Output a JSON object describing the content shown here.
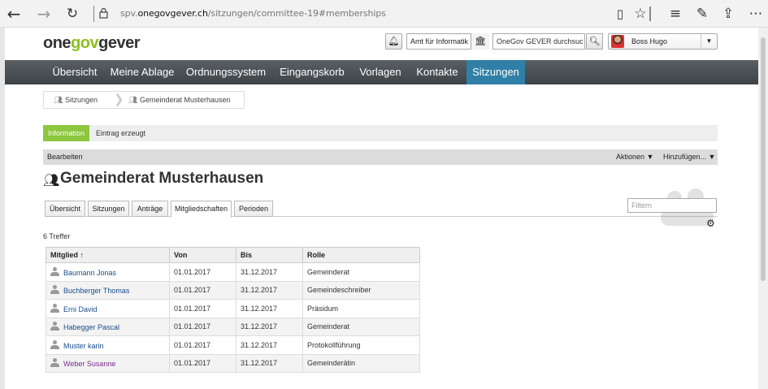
{
  "browser": {
    "url_prefix": "spv.",
    "url_domain": "onegovgever.ch",
    "url_path": "/sitzungen/committee-19#memberships"
  },
  "header": {
    "logo_one": "one",
    "logo_gov": "gov",
    "logo_gever": "gever",
    "org_unit": "Amt für Informatik",
    "search_placeholder": "OneGov GEVER durchsuc",
    "user_name": "Boss Hugo"
  },
  "nav": {
    "items": [
      "Übersicht",
      "Meine Ablage",
      "Ordnungssystem",
      "Eingangskorb",
      "Vorlagen",
      "Kontakte",
      "Sitzungen"
    ],
    "active": "Sitzungen"
  },
  "breadcrumb": [
    "Sitzungen",
    "Gemeinderat Musterhausen"
  ],
  "info": {
    "label": "Information",
    "message": "Eintrag erzeugt"
  },
  "editbar": {
    "edit": "Bearbeiten",
    "actions": "Aktionen ▼",
    "add": "Hinzufügen... ▼"
  },
  "page": {
    "title": "Gemeinderat Musterhausen"
  },
  "tabs": [
    "Übersicht",
    "Sitzungen",
    "Anträge",
    "Mitgliedschaften",
    "Perioden"
  ],
  "active_tab": "Mitgliedschaften",
  "filter_placeholder": "Filtern",
  "hits": "6 Treffer",
  "table": {
    "headers": [
      "Mitglied ↑",
      "Von",
      "Bis",
      "Rolle"
    ],
    "rows": [
      [
        "Baumann Jonas",
        "01.01.2017",
        "31.12.2017",
        "Gemeinderat"
      ],
      [
        "Buchberger Thomas",
        "01.01.2017",
        "31.12.2017",
        "Gemeindeschreiber"
      ],
      [
        "Erni David",
        "01.01.2017",
        "31.12.2017",
        "Präsidum"
      ],
      [
        "Habegger Pascal",
        "01.01.2017",
        "31.12.2017",
        "Gemeinderat"
      ],
      [
        "Muster karin",
        "01.01.2017",
        "31.12.2017",
        "Protokollführung"
      ],
      [
        "Weber Susanne",
        "01.01.2017",
        "31.12.2017",
        "Gemeinderätin"
      ]
    ]
  },
  "colors": {
    "accent": "#2f7fa6",
    "green": "#8dc63f",
    "link": "#1a4d8c",
    "visited_link": "#7a2a8c"
  }
}
